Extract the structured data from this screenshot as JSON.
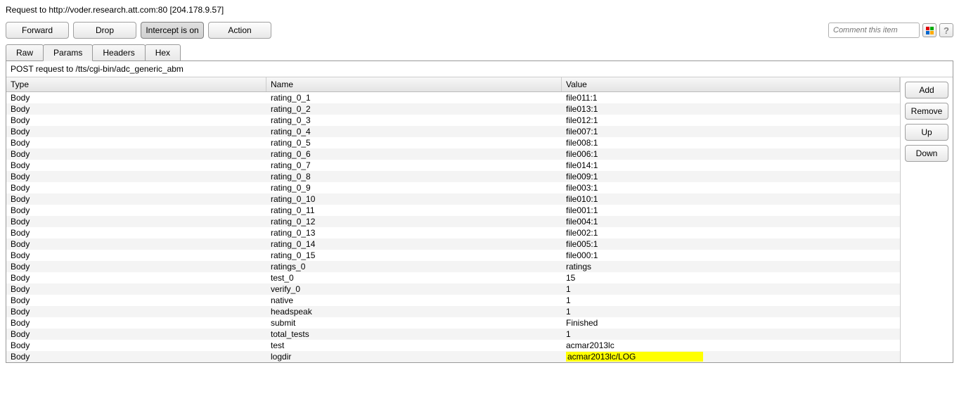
{
  "request_line": "Request to http://voder.research.att.com:80  [204.178.9.57]",
  "toolbar": {
    "forward": "Forward",
    "drop": "Drop",
    "intercept": "Intercept is on",
    "action": "Action",
    "comment_placeholder": "Comment this item"
  },
  "tabs": {
    "raw": "Raw",
    "params": "Params",
    "headers": "Headers",
    "hex": "Hex"
  },
  "post_line": "POST request to /tts/cgi-bin/adc_generic_abm",
  "table": {
    "headers": {
      "type": "Type",
      "name": "Name",
      "value": "Value"
    },
    "rows": [
      {
        "type": "Body",
        "name": "rating_0_1",
        "value": "file011:1"
      },
      {
        "type": "Body",
        "name": "rating_0_2",
        "value": "file013:1"
      },
      {
        "type": "Body",
        "name": "rating_0_3",
        "value": "file012:1"
      },
      {
        "type": "Body",
        "name": "rating_0_4",
        "value": "file007:1"
      },
      {
        "type": "Body",
        "name": "rating_0_5",
        "value": "file008:1"
      },
      {
        "type": "Body",
        "name": "rating_0_6",
        "value": "file006:1"
      },
      {
        "type": "Body",
        "name": "rating_0_7",
        "value": "file014:1"
      },
      {
        "type": "Body",
        "name": "rating_0_8",
        "value": "file009:1"
      },
      {
        "type": "Body",
        "name": "rating_0_9",
        "value": "file003:1"
      },
      {
        "type": "Body",
        "name": "rating_0_10",
        "value": "file010:1"
      },
      {
        "type": "Body",
        "name": "rating_0_11",
        "value": "file001:1"
      },
      {
        "type": "Body",
        "name": "rating_0_12",
        "value": "file004:1"
      },
      {
        "type": "Body",
        "name": "rating_0_13",
        "value": "file002:1"
      },
      {
        "type": "Body",
        "name": "rating_0_14",
        "value": "file005:1"
      },
      {
        "type": "Body",
        "name": "rating_0_15",
        "value": "file000:1"
      },
      {
        "type": "Body",
        "name": "ratings_0",
        "value": "ratings"
      },
      {
        "type": "Body",
        "name": "test_0",
        "value": "15"
      },
      {
        "type": "Body",
        "name": "verify_0",
        "value": "1"
      },
      {
        "type": "Body",
        "name": "native",
        "value": "1"
      },
      {
        "type": "Body",
        "name": "headspeak",
        "value": "1"
      },
      {
        "type": "Body",
        "name": "submit",
        "value": "Finished"
      },
      {
        "type": "Body",
        "name": "total_tests",
        "value": "1"
      },
      {
        "type": "Body",
        "name": "test",
        "value": "acmar2013lc"
      },
      {
        "type": "Body",
        "name": "logdir",
        "value": "acmar2013lc/LOG",
        "highlight": true
      }
    ]
  },
  "side": {
    "add": "Add",
    "remove": "Remove",
    "up": "Up",
    "down": "Down"
  }
}
